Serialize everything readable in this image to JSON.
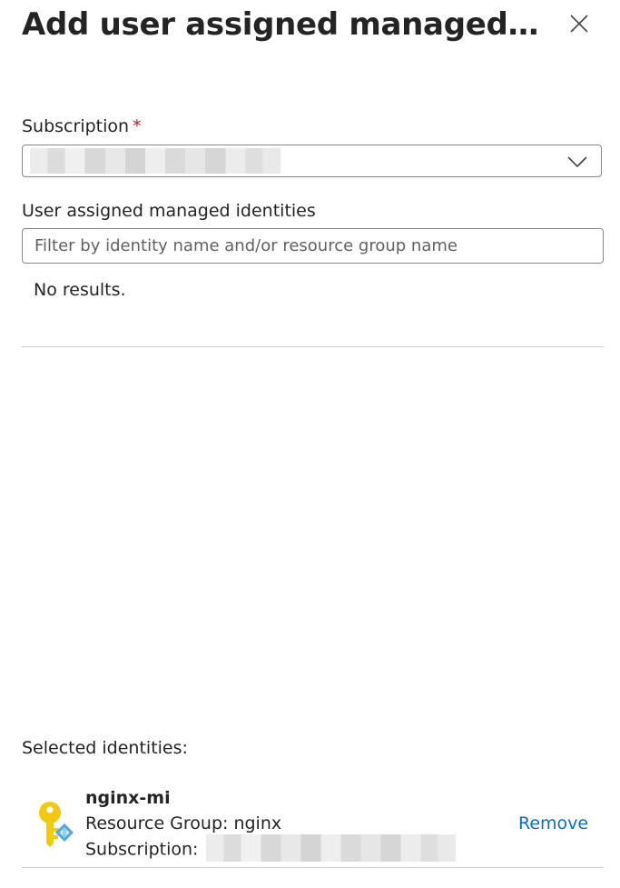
{
  "panel": {
    "title": "Add user assigned managed i..."
  },
  "subscription": {
    "label": "Subscription",
    "required_marker": "*"
  },
  "identities": {
    "label": "User assigned managed identities",
    "filter_placeholder": "Filter by identity name and/or resource group name",
    "filter_value": "",
    "empty_message": "No results."
  },
  "selected": {
    "label": "Selected identities:",
    "items": [
      {
        "name": "nginx-mi",
        "resource_group": "Resource Group: nginx",
        "subscription_label": "Subscription:",
        "remove_label": "Remove"
      }
    ]
  },
  "colors": {
    "link": "#0f6cbd",
    "required": "#a4262c",
    "key_icon": "#f2c811",
    "badge": "#50a8e0"
  },
  "icons": {
    "close": "close-icon",
    "dropdown": "chevron-down-icon",
    "identity": "managed-identity-key-icon"
  }
}
